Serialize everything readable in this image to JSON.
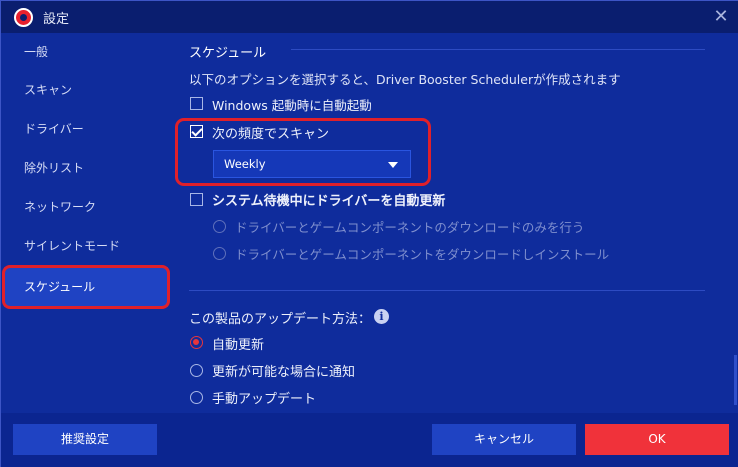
{
  "window": {
    "title": "設定",
    "close": "✕"
  },
  "sidebar": {
    "items": [
      {
        "label": "一般"
      },
      {
        "label": "スキャン"
      },
      {
        "label": "ドライバー"
      },
      {
        "label": "除外リスト"
      },
      {
        "label": "ネットワーク"
      },
      {
        "label": "サイレントモード"
      },
      {
        "label": "スケジュール",
        "active": true
      }
    ]
  },
  "schedule": {
    "section_title": "スケジュール",
    "description": "以下のオプションを選択すると、Driver Booster Schedulerが作成されます",
    "options": {
      "windows_startup": {
        "label": "Windows 起動時に自動起動",
        "checked": false
      },
      "scan_frequency": {
        "label": "次の頻度でスキャン",
        "checked": true
      },
      "idle_update": {
        "label": "システム待機中にドライバーを自動更新",
        "checked": false
      }
    },
    "frequency_dropdown": {
      "value": "Weekly"
    },
    "idle_suboptions": [
      {
        "label": "ドライバーとゲームコンポーネントのダウンロードのみを行う"
      },
      {
        "label": "ドライバーとゲームコンポーネントをダウンロードしインストール"
      }
    ]
  },
  "update": {
    "title": "この製品のアップデート方法：",
    "info_icon": "i",
    "options": [
      {
        "label": "自動更新",
        "selected": true
      },
      {
        "label": "更新が可能な場合に通知",
        "selected": false
      },
      {
        "label": "手動アップデート",
        "selected": false
      }
    ]
  },
  "footer": {
    "recommended": "推奨設定",
    "cancel": "キャンセル",
    "ok": "OK"
  },
  "colors": {
    "background": "#0f2c9c",
    "titlebar": "#0a1e6f",
    "accent_red": "#f0323a",
    "button_blue": "#1f43c3"
  }
}
